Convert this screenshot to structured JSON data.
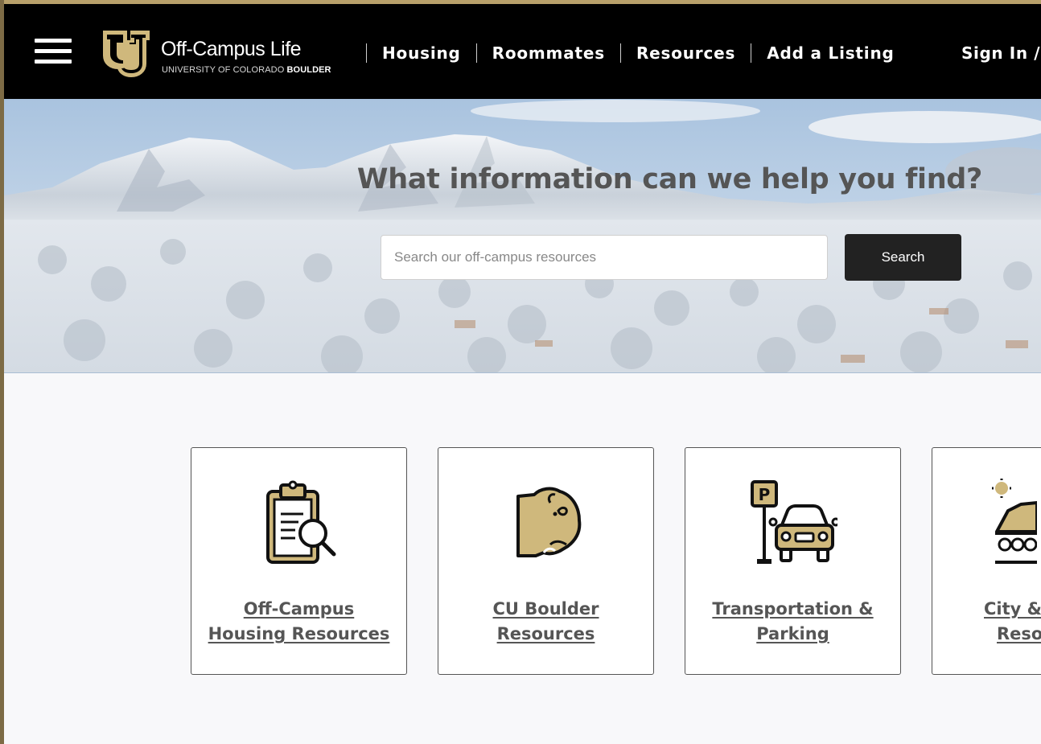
{
  "header": {
    "brand": {
      "title": "Off-Campus Life",
      "subtitle_prefix": "UNIVERSITY OF COLORADO",
      "subtitle_bold": "BOULDER"
    },
    "nav": [
      {
        "label": "Housing"
      },
      {
        "label": "Roommates"
      },
      {
        "label": "Resources"
      },
      {
        "label": "Add a Listing"
      }
    ],
    "signin": "Sign In / S"
  },
  "hero": {
    "title": "What information can we help you find?",
    "search_placeholder": "Search our off-campus resources",
    "search_button": "Search"
  },
  "cards": [
    {
      "line1": "Off-Campus",
      "line2": "Housing Resources",
      "icon": "clipboard-search-icon"
    },
    {
      "line1": "CU Boulder",
      "line2": "Resources",
      "icon": "buffalo-icon"
    },
    {
      "line1": "Transportation &",
      "line2": "Parking",
      "icon": "car-parking-icon"
    },
    {
      "line1": "City & C",
      "line2": "Resou",
      "icon": "city-mountain-icon"
    }
  ],
  "colors": {
    "gold": "#cfb87c",
    "header_bg": "#000000",
    "button_bg": "#222222",
    "card_text": "#555555"
  }
}
